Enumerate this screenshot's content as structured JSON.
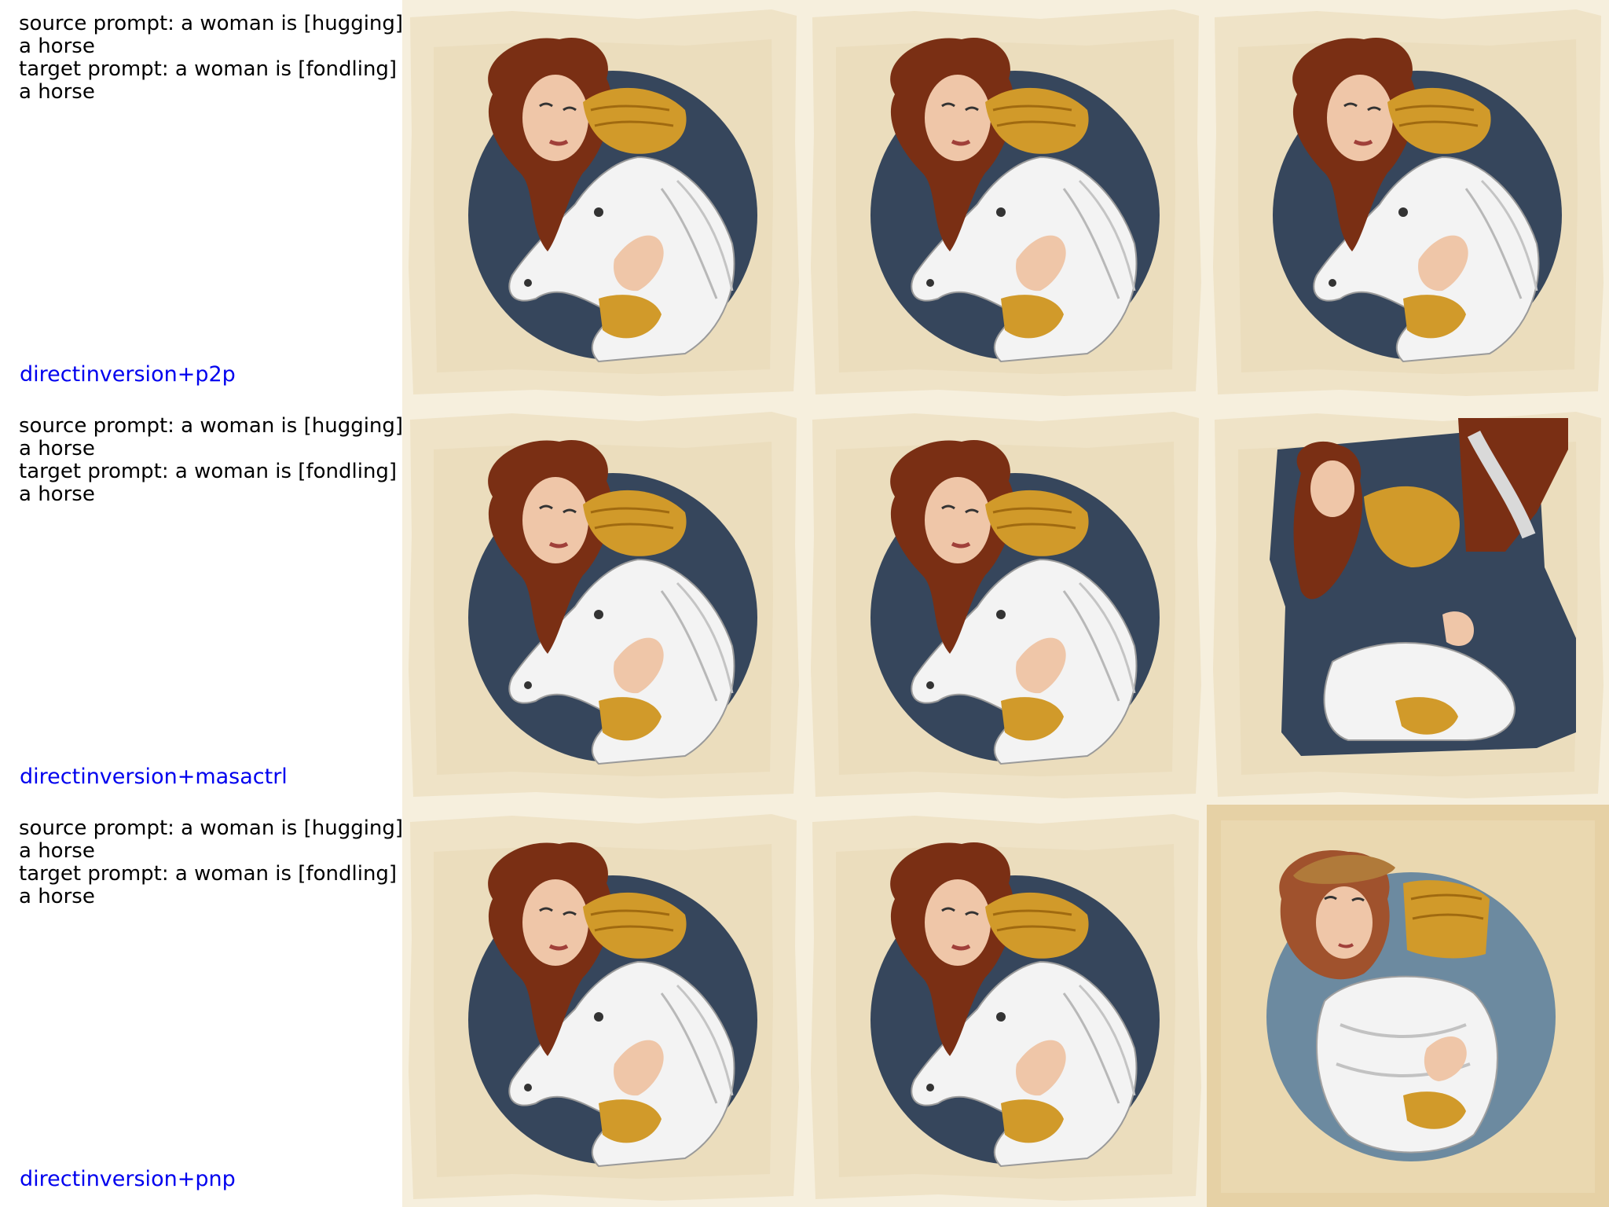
{
  "colors": {
    "method_label": "#0000ee",
    "paper_bg": "#efe3c7",
    "paper_inner": "#e8d8b4",
    "disc": "#36465c",
    "disc_alt": "#6c8aa0",
    "hair": "#7a2f14",
    "gold": "#d19a2a",
    "skin": "#efc6a8",
    "horse": "#f3f3f3"
  },
  "rows": [
    {
      "source_prompt": "source prompt: a woman is [hugging] a horse",
      "target_prompt": "target prompt: a woman is [fondling] a horse",
      "method": "directinversion+p2p",
      "images": [
        {
          "name": "source-image",
          "variant": "standard"
        },
        {
          "name": "reconstruction-image",
          "variant": "standard"
        },
        {
          "name": "edited-image",
          "variant": "standard"
        }
      ]
    },
    {
      "source_prompt": "source prompt: a woman is [hugging] a horse",
      "target_prompt": "target prompt: a woman is [fondling] a horse",
      "method": "directinversion+masactrl",
      "images": [
        {
          "name": "source-image",
          "variant": "standard"
        },
        {
          "name": "reconstruction-image",
          "variant": "standard"
        },
        {
          "name": "edited-image",
          "variant": "distorted"
        }
      ]
    },
    {
      "source_prompt": "source prompt: a woman is [hugging] a horse",
      "target_prompt": "target prompt: a woman is [fondling] a horse",
      "method": "directinversion+pnp",
      "images": [
        {
          "name": "source-image",
          "variant": "standard"
        },
        {
          "name": "reconstruction-image",
          "variant": "standard"
        },
        {
          "name": "edited-image",
          "variant": "lightblue"
        }
      ]
    }
  ]
}
